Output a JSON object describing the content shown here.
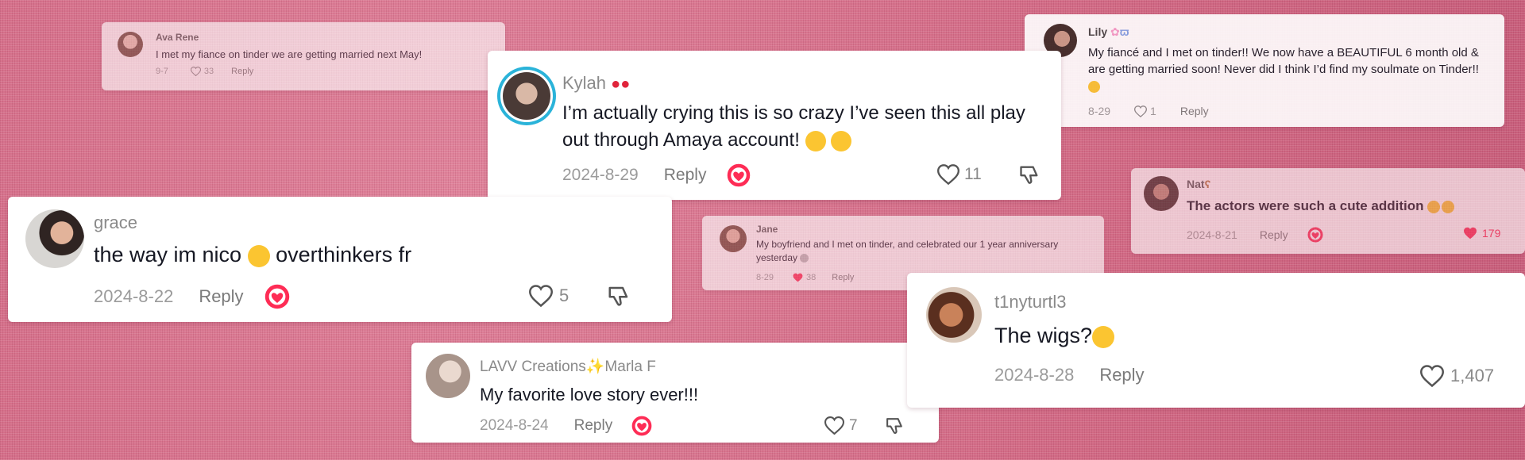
{
  "colors": {
    "background": "#d9758f",
    "card": "#ffffff",
    "text": "#161823",
    "muted": "#8a8a8a",
    "heart_liked": "#fe2c55",
    "creator_badge": "#fe2c55"
  },
  "comments": [
    {
      "username": "Ava Rene",
      "text": "I met my fiance on tinder we are getting married next May!",
      "date": "9-7",
      "reply": "Reply",
      "likes": "33"
    },
    {
      "username": "Kylah",
      "text": "I’m actually crying this is so crazy I’ve seen this all play out through Amaya account!",
      "date": "2024-8-29",
      "reply": "Reply",
      "likes": "11"
    },
    {
      "username": "Lily",
      "text": "My fiancé and I met on tinder!! We now have a BEAUTIFUL 6 month old & are getting married soon! Never did I think I’d find my soulmate on Tinder!!",
      "date": "8-29",
      "reply": "Reply",
      "likes": "1"
    },
    {
      "username": "grace",
      "text": "the way im nico",
      "text_after": "overthinkers fr",
      "date": "2024-8-22",
      "reply": "Reply",
      "likes": "5"
    },
    {
      "username": "Nat",
      "text": "The actors were such a cute addition",
      "date": "2024-8-21",
      "reply": "Reply",
      "likes": "179"
    },
    {
      "username": "Jane",
      "text": "My boyfriend and I met on tinder, and celebrated our 1 year anniversary yesterday",
      "date": "8-29",
      "reply": "Reply",
      "likes": "38"
    },
    {
      "username": "t1nyturtl3",
      "text": "The wigs?",
      "date": "2024-8-28",
      "reply": "Reply",
      "likes": "1,407"
    },
    {
      "username": "LAVV Creations✨Marla F",
      "text": "My favorite love story ever!!!",
      "date": "2024-8-24",
      "reply": "Reply",
      "likes": "7"
    }
  ]
}
